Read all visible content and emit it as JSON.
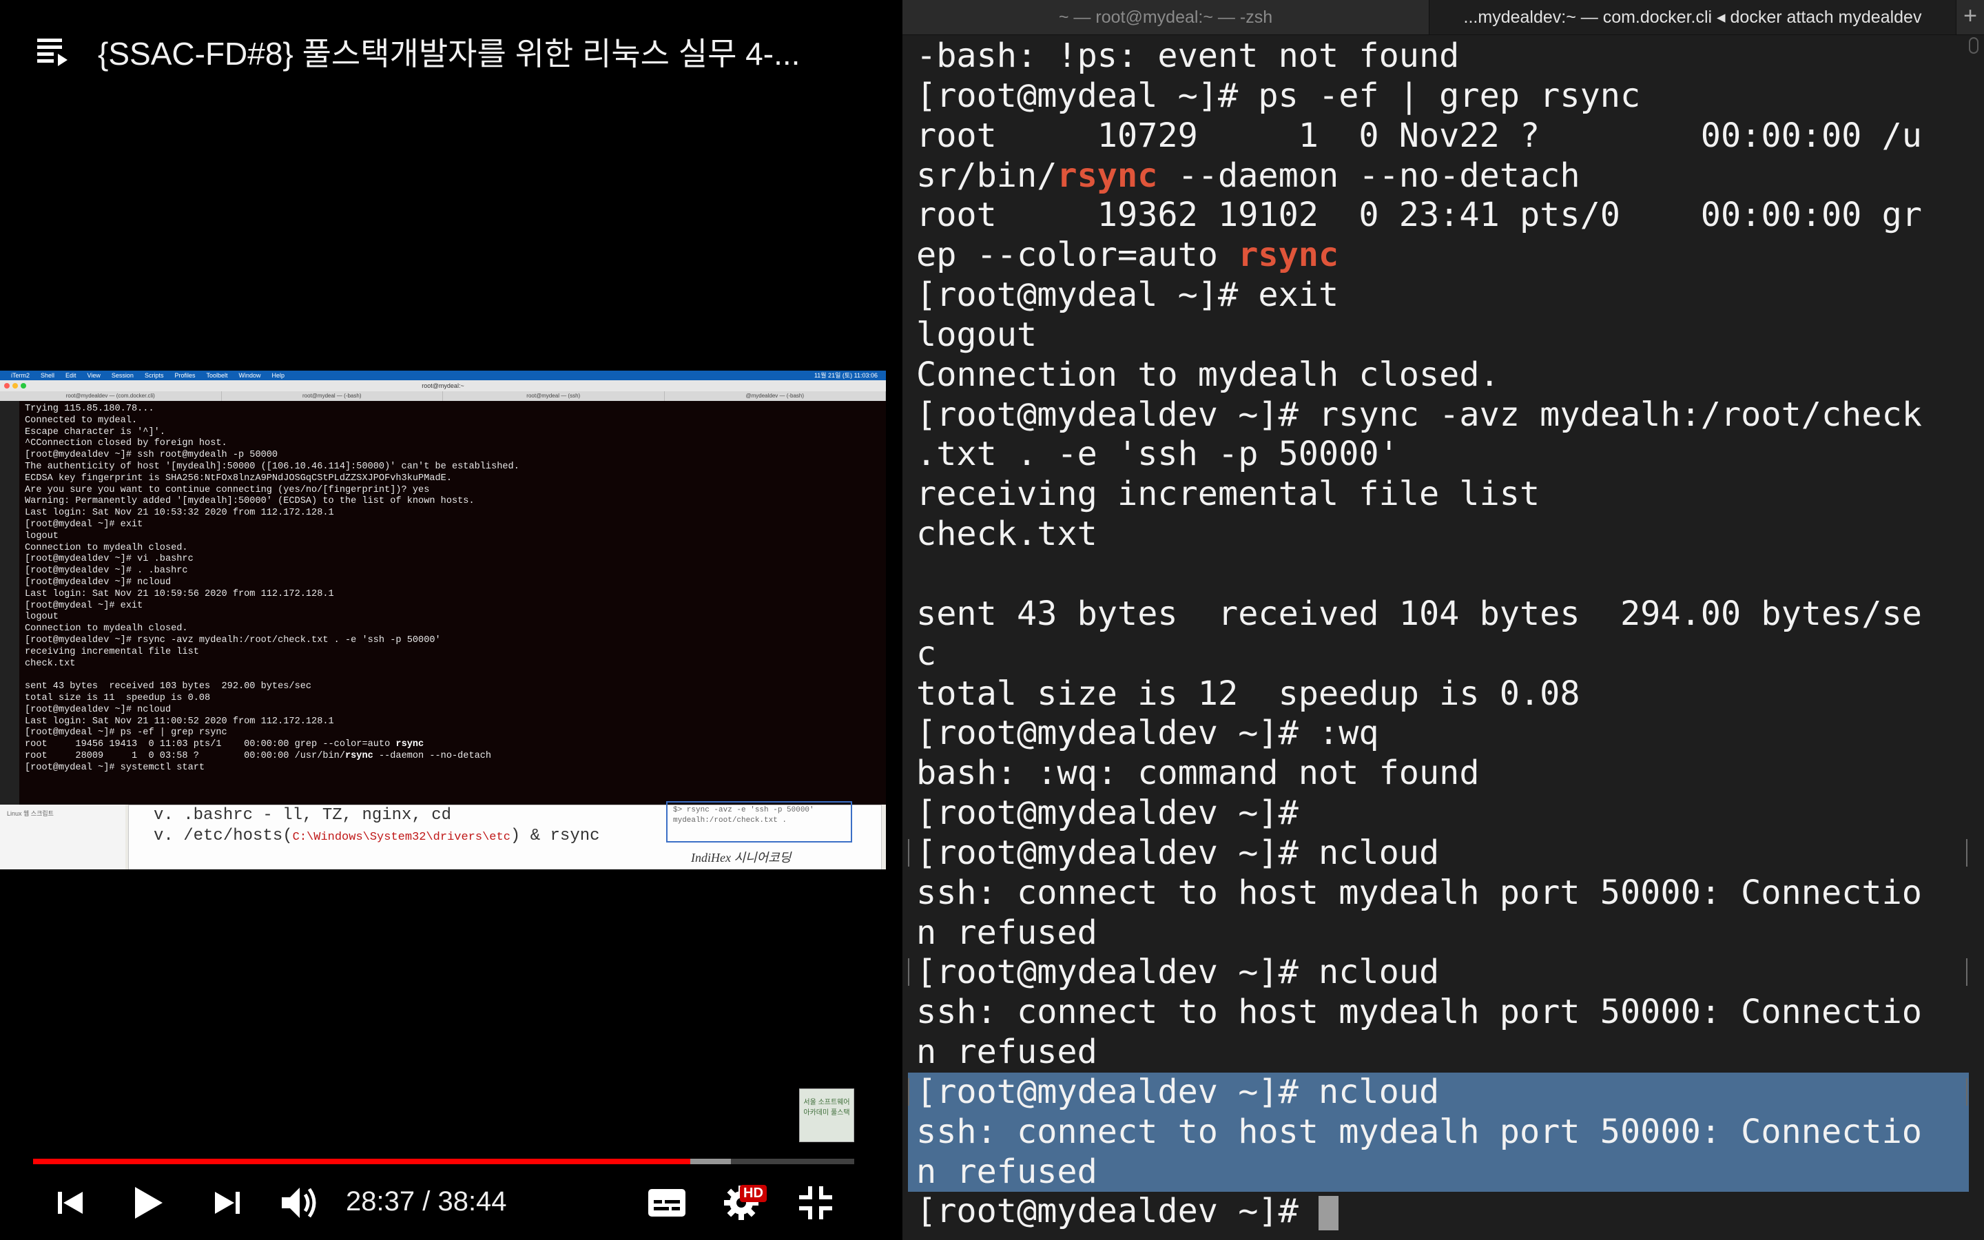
{
  "video": {
    "title": "{SSAC-FD#8} 풀스택개발자를 위한 리눅스 실무 4-...",
    "progress": 0.8,
    "buffered": 0.85,
    "time": {
      "current": "28:37",
      "separator": " / ",
      "duration": "38:44"
    },
    "hd_badge": "HD",
    "frame": {
      "mac_menu": [
        "iTerm2",
        "Shell",
        "Edit",
        "View",
        "Session",
        "Scripts",
        "Profiles",
        "Toolbelt",
        "Window",
        "Help"
      ],
      "mac_clock": "11월 21일 (토) 11:03:06",
      "window_title": "root@mydeal:~",
      "tabs": [
        "root@mydealdev — (com.docker.cli)",
        "root@mydeal — (-bash)",
        "root@mydeal — (ssh)",
        "@mydealdev — (-bash)"
      ],
      "terminal_lines": [
        "Trying 115.85.180.78...",
        "Connected to mydeal.",
        "Escape character is '^]'.",
        "^CConnection closed by foreign host.",
        "[root@mydealdev ~]# ssh root@mydealh -p 50000",
        "The authenticity of host '[mydealh]:50000 ([106.10.46.114]:50000)' can't be established.",
        "ECDSA key fingerprint is SHA256:NtFOx8lnzA9PNdJOSGqCStPLdZZSXJPOFvh3kuPMadE.",
        "Are you sure you want to continue connecting (yes/no/[fingerprint])? yes",
        "Warning: Permanently added '[mydealh]:50000' (ECDSA) to the list of known hosts.",
        "Last login: Sat Nov 21 10:53:32 2020 from 112.172.128.1",
        "[root@mydeal ~]# exit",
        "logout",
        "Connection to mydealh closed.",
        "[root@mydealdev ~]# vi .bashrc",
        "[root@mydealdev ~]# . .bashrc",
        "[root@mydealdev ~]# ncloud",
        "Last login: Sat Nov 21 10:59:56 2020 from 112.172.128.1",
        "[root@mydeal ~]# exit",
        "logout",
        "Connection to mydealh closed.",
        "[root@mydealdev ~]# rsync -avz mydealh:/root/check.txt . -e 'ssh -p 50000'",
        "receiving incremental file list",
        "check.txt",
        "",
        "sent 43 bytes  received 103 bytes  292.00 bytes/sec",
        "total size is 11  speedup is 0.08",
        "[root@mydealdev ~]# ncloud",
        "Last login: Sat Nov 21 11:00:52 2020 from 112.172.128.1",
        "[root@mydeal ~]# ps -ef | grep rsync",
        "root     19456 19413  0 11:03 pts/1    00:00:00 grep --color=auto rsync",
        "root     28009     1  0 03:58 ?        00:00:00 /usr/bin/rsync --daemon --no-detach",
        "[root@mydeal ~]# systemctl start "
      ],
      "slide_bullets": [
        "v. .bashrc - ll, TZ, nginx, cd",
        "v. /etc/hosts("
      ],
      "slide_path": "C:\\Windows\\System32\\drivers\\etc",
      "slide_suffix": ") & rsync",
      "slide_note": "$> rsync -avz -e 'ssh -p 50000'\nmydealh:/root/check.txt .",
      "signature": "IndiHex 시니어코딩",
      "sidebar_label": "Linux 웹 스크립트"
    },
    "channel_logo": "서울 소프트웨어 아카데미 풀스택"
  },
  "terminal": {
    "tabs": [
      {
        "label": "~ — root@mydeal:~ — -zsh",
        "active": false
      },
      {
        "label": "...mydealdev:~ — com.docker.cli ◂ docker attach mydealdev",
        "active": true
      }
    ],
    "new_tab": "+",
    "lines": [
      {
        "text": "-bash: !ps: event not found"
      },
      {
        "text": "[root@mydeal ~]# ps -ef | grep rsync"
      },
      {
        "text": "root     10729     1  0 Nov22 ?        00:00:00 /u"
      },
      {
        "pre": "sr/bin/",
        "hl": "rsync",
        "post": " --daemon --no-detach"
      },
      {
        "text": "root     19362 19102  0 23:41 pts/0    00:00:00 gr"
      },
      {
        "pre": "ep --color=auto ",
        "hl": "rsync",
        "post": ""
      },
      {
        "text": "[root@mydeal ~]# exit"
      },
      {
        "text": "logout"
      },
      {
        "text": "Connection to mydealh closed."
      },
      {
        "text": "[root@mydealdev ~]# rsync -avz mydealh:/root/check"
      },
      {
        "text": ".txt . -e 'ssh -p 50000'"
      },
      {
        "text": "receiving incremental file list"
      },
      {
        "text": "check.txt"
      },
      {
        "text": ""
      },
      {
        "text": "sent 43 bytes  received 104 bytes  294.00 bytes/se"
      },
      {
        "text": "c"
      },
      {
        "text": "total size is 12  speedup is 0.08"
      },
      {
        "text": "[root@mydealdev ~]# :wq"
      },
      {
        "text": "bash: :wq: command not found"
      },
      {
        "text": "[root@mydealdev ~]#"
      },
      {
        "text": "[root@mydealdev ~]# ncloud",
        "mark": true
      },
      {
        "text": "ssh: connect to host mydealh port 50000: Connectio"
      },
      {
        "text": "n refused"
      },
      {
        "text": "[root@mydealdev ~]# ncloud",
        "mark": true
      },
      {
        "text": "ssh: connect to host mydealh port 50000: Connectio"
      },
      {
        "text": "n refused"
      },
      {
        "text": "[root@mydealdev ~]# ncloud",
        "selected": true,
        "mark": true
      },
      {
        "text": "ssh: connect to host mydealh port 50000: Connectio",
        "selected": true
      },
      {
        "text": "n refused",
        "selected": true
      },
      {
        "text": "[root@mydealdev ~]# ",
        "cursor": true
      }
    ]
  },
  "colors": {
    "progress": "#ff0000",
    "rsync_highlight": "#e0553a",
    "selection": "#496d93",
    "terminal_bg": "#1e1e1e"
  }
}
